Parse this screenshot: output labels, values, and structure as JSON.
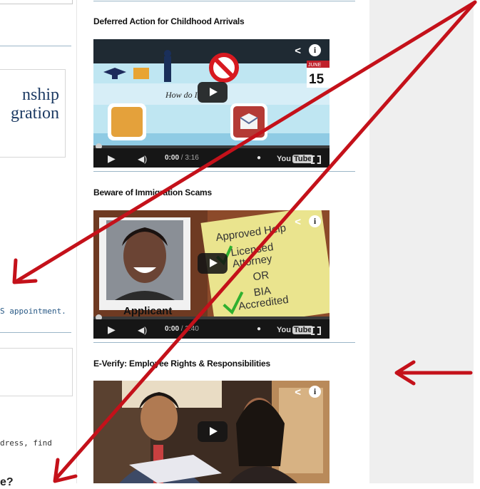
{
  "left_column": {
    "logo_lines": [
      "nship",
      "gration"
    ],
    "appointment_link": "S appointment.",
    "truncated_text": "dress, find",
    "truncated_heading": "e?"
  },
  "videos": [
    {
      "title": "Deferred Action for Childhood Arrivals",
      "current_time": "0:00",
      "duration": "/ 3:16",
      "thumb_caption": "How do I",
      "calendar_month": "JUNE",
      "calendar_day": "15"
    },
    {
      "title": "Beware of Immigration Scams",
      "current_time": "0:00",
      "duration": "/ 2:40",
      "card_lines": [
        "Approved Help",
        "Licensed",
        "Attorney",
        "OR",
        "BIA",
        "Accredited"
      ],
      "badge": "Applicant"
    },
    {
      "title": "E-Verify: Employee Rights & Responsibilities"
    }
  ],
  "youtube_label": "You",
  "youtube_tube": "Tube",
  "colors": {
    "arrow": "#c4111a",
    "rule": "#9bb6c8",
    "right_panel": "#efefef"
  }
}
